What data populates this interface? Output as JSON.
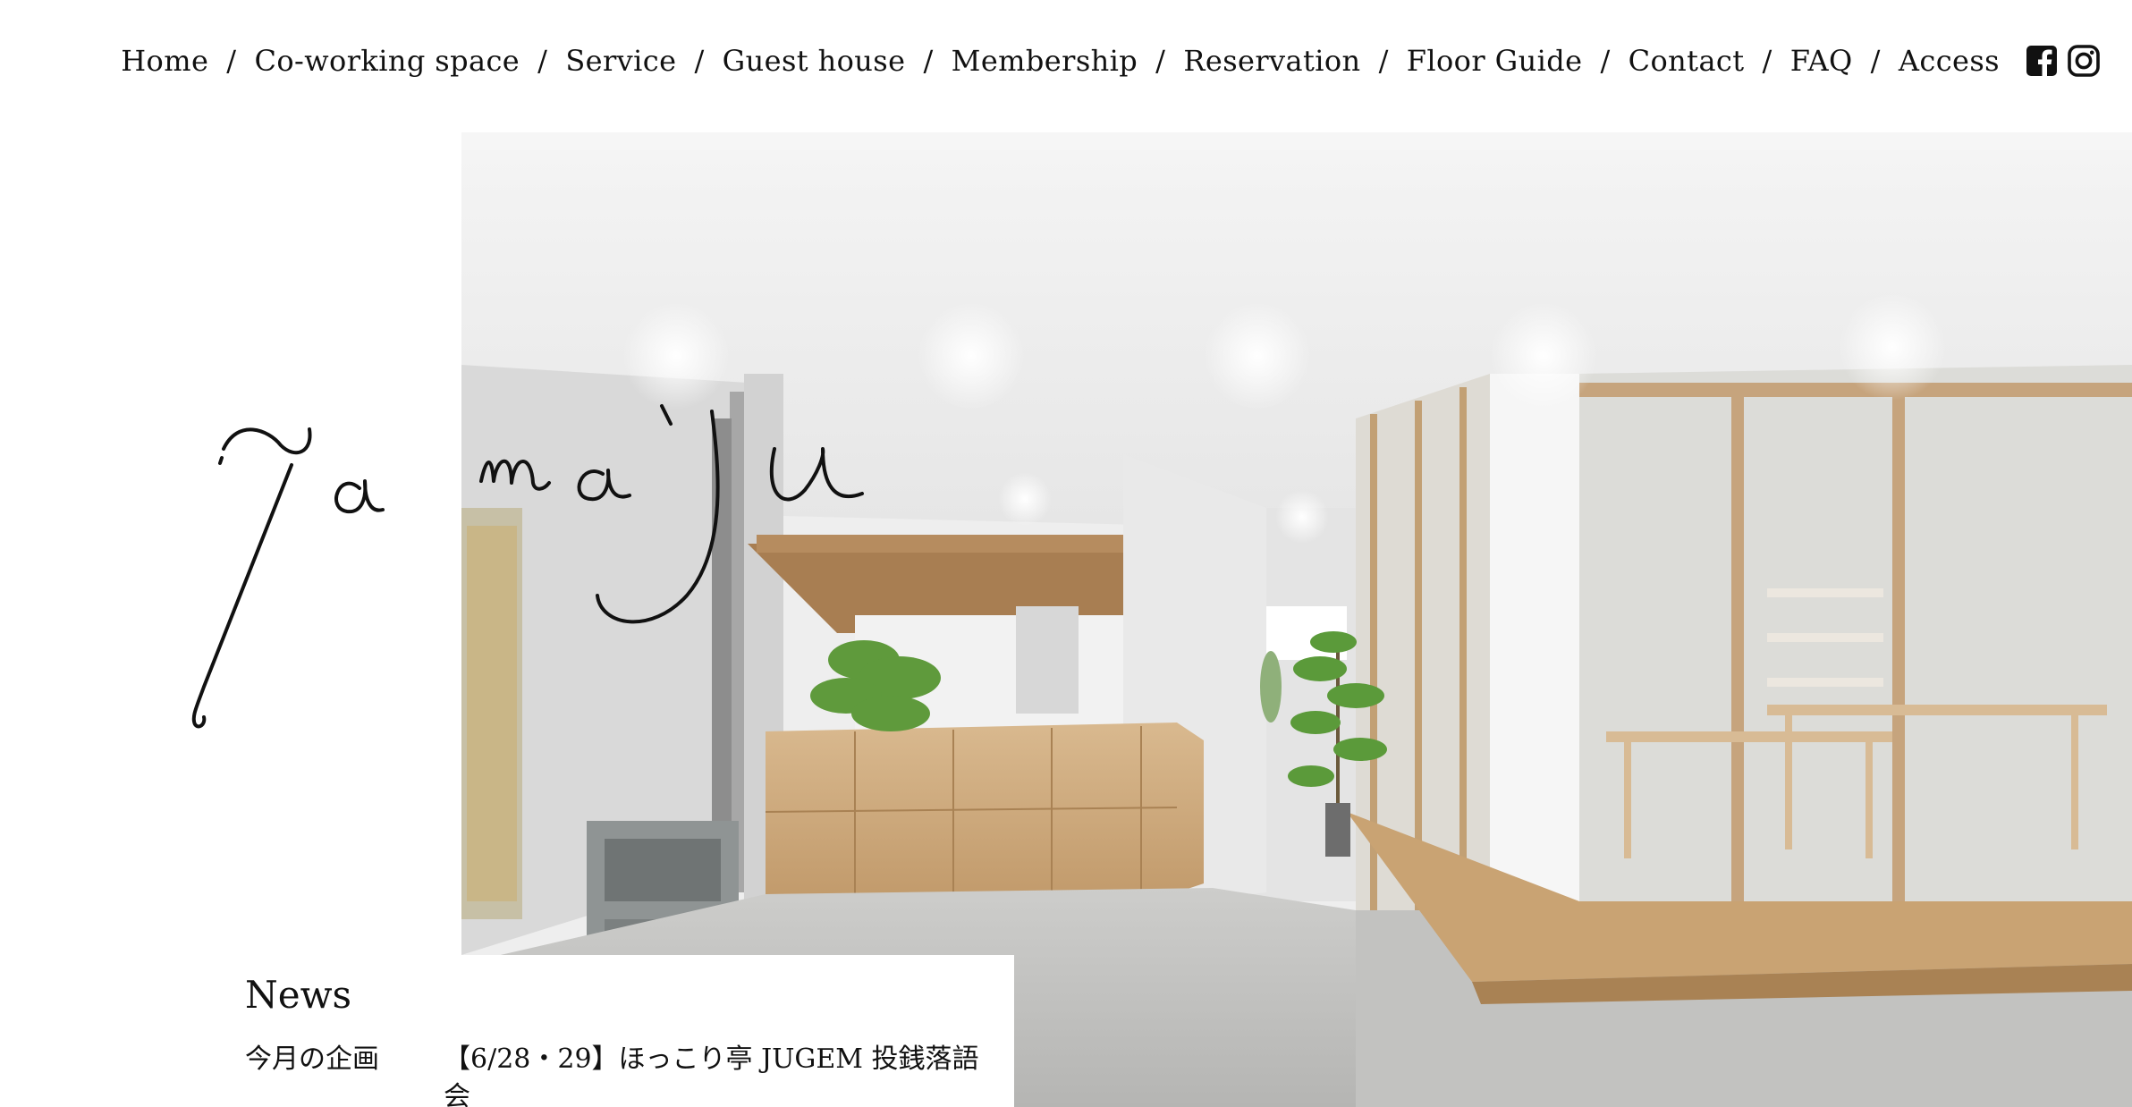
{
  "nav": {
    "items": [
      {
        "label": "Home"
      },
      {
        "label": "Co-working space"
      },
      {
        "label": "Service"
      },
      {
        "label": "Guest house"
      },
      {
        "label": "Membership"
      },
      {
        "label": "Reservation"
      },
      {
        "label": "Floor Guide"
      },
      {
        "label": "Contact"
      },
      {
        "label": "FAQ"
      },
      {
        "label": "Access"
      }
    ],
    "separator": "/",
    "social_icons": [
      "facebook-icon",
      "instagram-icon"
    ]
  },
  "logo": {
    "text": "ya maju",
    "style": "handwritten-script"
  },
  "hero": {
    "subject": "interior-rendering",
    "palette": {
      "wall": "#f2f2f2",
      "floor": "#bfbfbd",
      "wood": "#c8a37a",
      "plant": "#4f8a34"
    }
  },
  "news": {
    "title": "News",
    "items": [
      {
        "category": "今月の企画",
        "text": "【6/28・29】ほっこり亭 JUGEM 投銭落語会"
      }
    ]
  },
  "colors": {
    "text": "#111111",
    "background": "#ffffff"
  }
}
